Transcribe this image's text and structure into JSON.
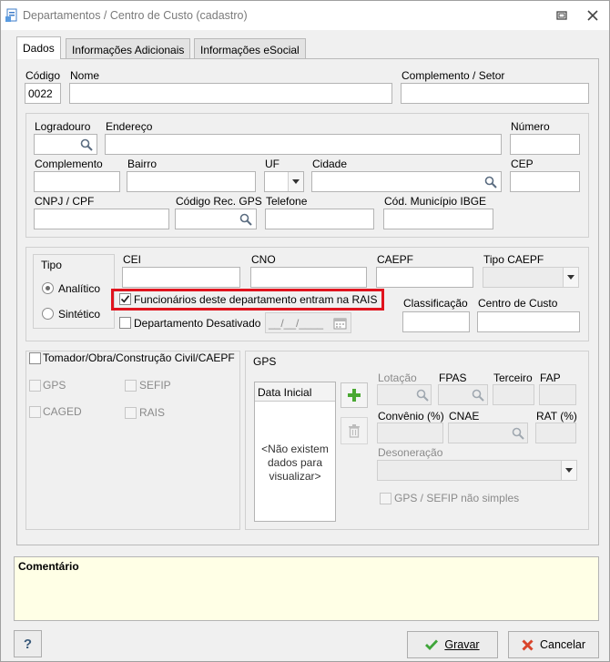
{
  "window": {
    "title": "Departamentos / Centro de Custo (cadastro)"
  },
  "tabs": [
    {
      "label": "Dados"
    },
    {
      "label": "Informações Adicionais"
    },
    {
      "label": "Informações eSocial"
    }
  ],
  "header": {
    "codigo_label": "Código",
    "codigo_value": "0022",
    "nome_label": "Nome",
    "nome_value": "",
    "complemento_setor_label": "Complemento / Setor",
    "complemento_setor_value": ""
  },
  "address": {
    "logradouro_label": "Logradouro",
    "endereco_label": "Endereço",
    "numero_label": "Número",
    "complemento_label": "Complemento",
    "bairro_label": "Bairro",
    "uf_label": "UF",
    "cidade_label": "Cidade",
    "cep_label": "CEP",
    "cnpj_label": "CNPJ / CPF",
    "codigo_rec_gps_label": "Código Rec. GPS",
    "telefone_label": "Telefone",
    "cod_municipio_label": "Cód. Município IBGE"
  },
  "tipo": {
    "label": "Tipo",
    "options": [
      {
        "label": "Analítico",
        "selected": true
      },
      {
        "label": "Sintético",
        "selected": false
      }
    ]
  },
  "fiscal": {
    "cei_label": "CEI",
    "cno_label": "CNO",
    "caepf_label": "CAEPF",
    "tipo_caepf_label": "Tipo CAEPF",
    "rais_checkbox_label": "Funcionários deste departamento entram na RAIS",
    "rais_checked": true,
    "desativado_label": "Departamento Desativado",
    "desativado_checked": false,
    "date_placeholder": "__/__/____",
    "classificacao_label": "Classificação",
    "centro_custo_label": "Centro de Custo",
    "highlight_color": "#e0141e"
  },
  "tomador": {
    "label": "Tomador/Obra/Construção Civil/CAEPF",
    "items": [
      "GPS",
      "SEFIP",
      "CAGED",
      "RAIS"
    ]
  },
  "gps": {
    "label": "GPS",
    "list_header": "Data Inicial",
    "empty_text": "<Não existem dados para visualizar>",
    "lotacao_label": "Lotação",
    "fpas_label": "FPAS",
    "terceiro_label": "Terceiro",
    "fap_label": "FAP",
    "convenio_label": "Convênio (%)",
    "cnae_label": "CNAE",
    "rat_label": "RAT (%)",
    "desoneracao_label": "Desoneração",
    "gps_sefip_label": "GPS / SEFIP não simples"
  },
  "comentario": {
    "label": "Comentário",
    "background": "#ffffe6"
  },
  "footer": {
    "help_label": "?",
    "gravar_label": "Gravar",
    "cancelar_label": "Cancelar"
  }
}
